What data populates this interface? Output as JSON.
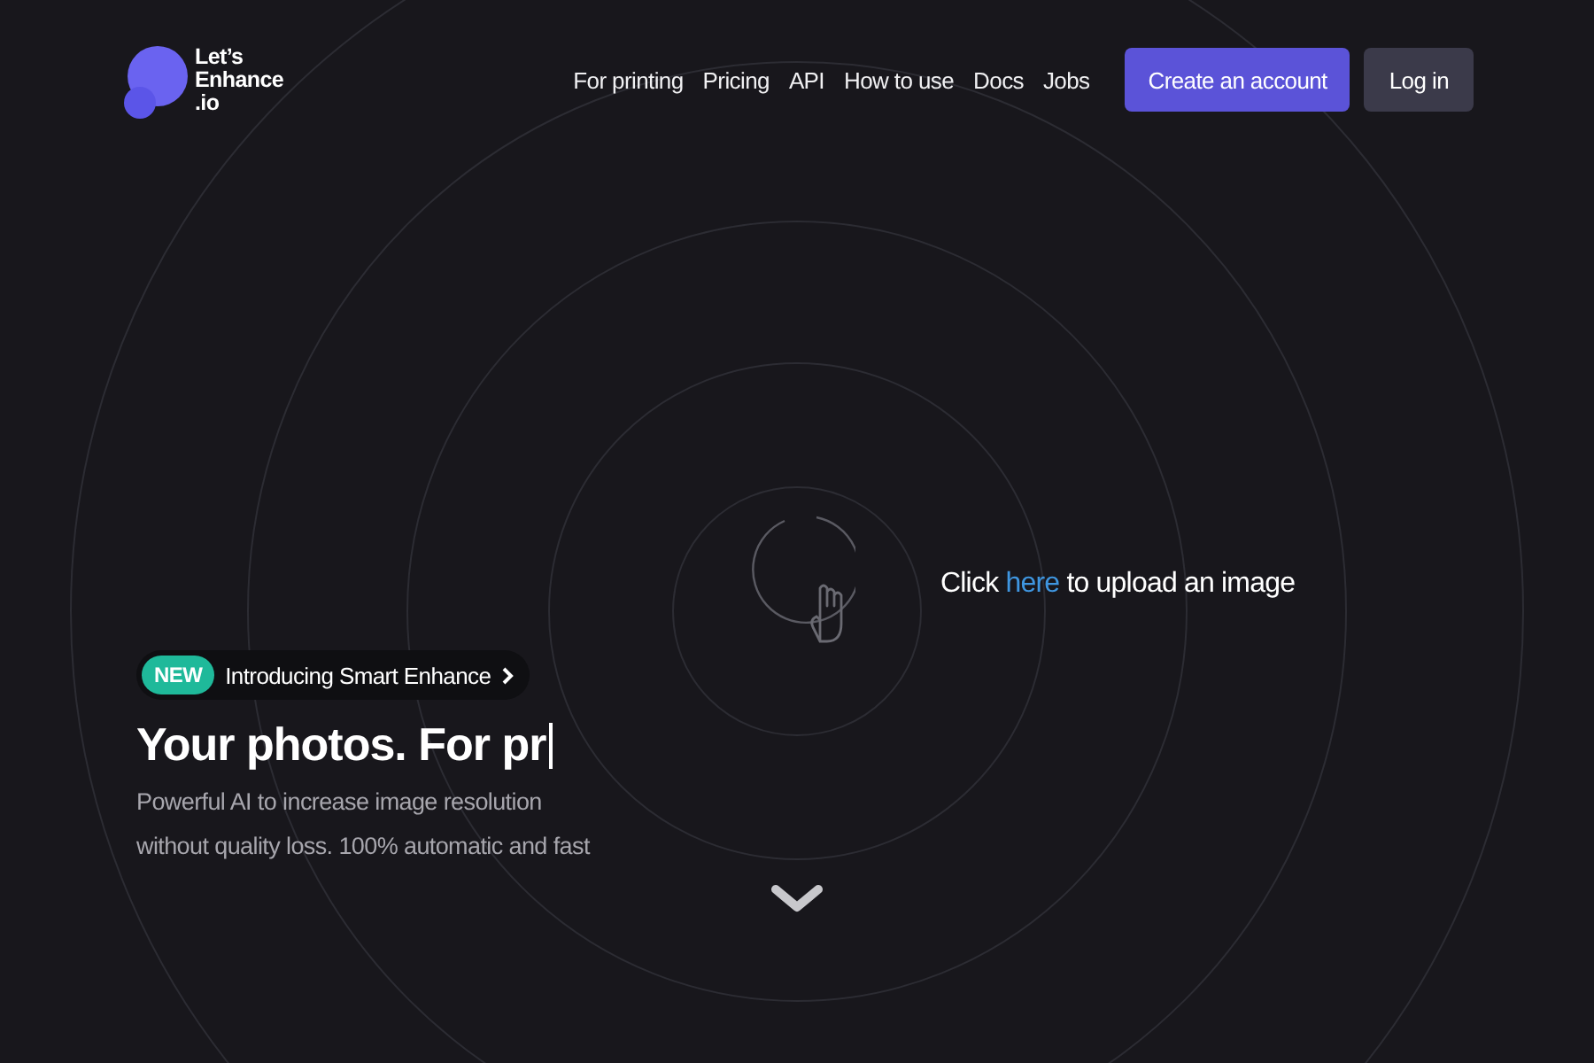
{
  "logo": {
    "lines": [
      "Let’s",
      "Enhance",
      ".io"
    ]
  },
  "nav": {
    "links": [
      "For printing",
      "Pricing",
      "API",
      "How to use",
      "Docs",
      "Jobs"
    ],
    "buttons": [
      {
        "label": "Create an account",
        "kind": "primary"
      },
      {
        "label": "Log in",
        "kind": "secondary"
      }
    ]
  },
  "upload": {
    "before": "Click",
    "link": "here",
    "after": "to upload an image"
  },
  "hero": {
    "badge": "NEW",
    "announcement": "Introducing Smart Enhance",
    "heading": "Your photos. For pr",
    "description_lines": [
      "Powerful AI to increase image resolution",
      "without quality loss. 100% automatic and fast"
    ]
  }
}
